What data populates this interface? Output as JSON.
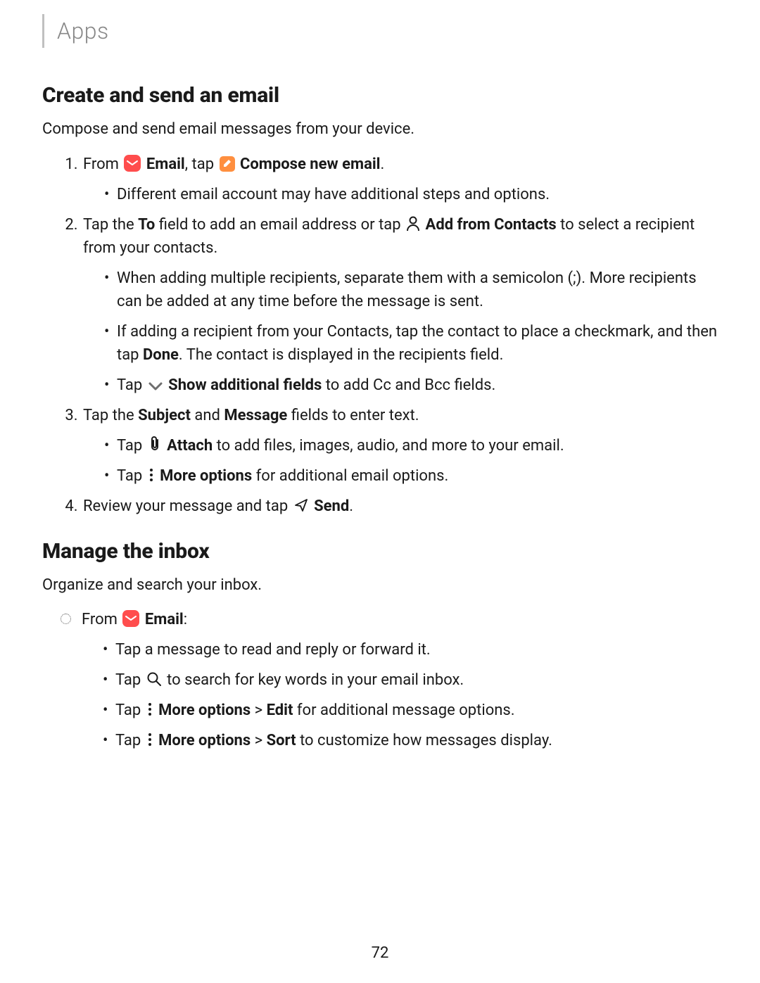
{
  "breadcrumb": "Apps",
  "section1": {
    "heading": "Create and send an email",
    "lead": "Compose and send email messages from your device.",
    "step1": {
      "t1": "From ",
      "email": "Email",
      "t2": ", tap ",
      "compose": "Compose new email",
      "t3": ".",
      "sub": [
        "Different email account may have additional steps and options."
      ]
    },
    "step2": {
      "t1": "Tap the ",
      "to": "To",
      "t2": " field to add an email address or tap ",
      "addc": "Add from Contacts",
      "t3": " to select a recipient from your contacts.",
      "sub": [
        "When adding multiple recipients, separate them with a semicolon (;). More recipients can be added at any time before the message is sent.",
        {
          "t1": "If adding a recipient from your Contacts, tap the contact to place a checkmark, and then tap ",
          "done": "Done",
          "t2": ". The contact is displayed in the recipients field."
        },
        {
          "t1": "Tap ",
          "show": "Show additional fields",
          "t2": " to add Cc and Bcc fields."
        }
      ]
    },
    "step3": {
      "t1": "Tap the ",
      "subject": "Subject",
      "t2": " and ",
      "message": "Message",
      "t3": " fields to enter text.",
      "sub": [
        {
          "t1": "Tap ",
          "attach": "Attach",
          "t2": " to add files, images, audio, and more to your email."
        },
        {
          "t1": "Tap ",
          "more": "More options",
          "t2": " for additional email options."
        }
      ]
    },
    "step4": {
      "t1": "Review your message and tap ",
      "send": "Send",
      "t2": "."
    }
  },
  "section2": {
    "heading": "Manage the inbox",
    "lead": "Organize and search your inbox.",
    "from": {
      "t1": "From ",
      "email": "Email",
      "t2": ":"
    },
    "sub": [
      "Tap a message to read and reply or forward it.",
      {
        "t1": "Tap ",
        "t2": " to search for key words in your email inbox."
      },
      {
        "t1": "Tap ",
        "more": "More options",
        "gt": " > ",
        "edit": "Edit",
        "t2": " for additional message options."
      },
      {
        "t1": "Tap ",
        "more": "More options",
        "gt": " > ",
        "sort": "Sort",
        "t2": " to customize how messages display."
      }
    ]
  },
  "page_number": "72"
}
